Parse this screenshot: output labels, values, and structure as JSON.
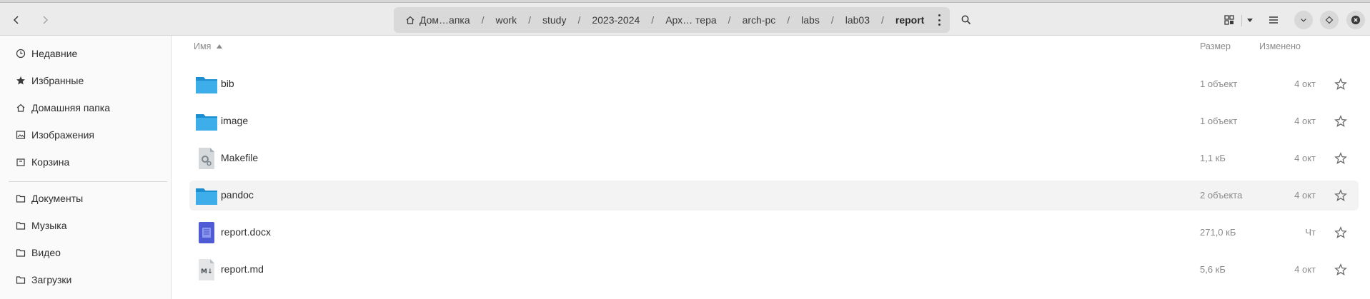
{
  "colors": {
    "folder": "#3daee9",
    "accent": "#3a3a3a",
    "doc": "#4f5bd5"
  },
  "pathbar": {
    "crumbs": [
      {
        "label": "Дом…апка",
        "icon": "home-icon"
      },
      {
        "label": "work"
      },
      {
        "label": "study"
      },
      {
        "label": "2023-2024"
      },
      {
        "label": "Арх… тера"
      },
      {
        "label": "arch-pc"
      },
      {
        "label": "labs"
      },
      {
        "label": "lab03"
      },
      {
        "label": "report"
      }
    ],
    "separator": "/"
  },
  "sidebar": {
    "items": [
      {
        "label": "Недавние",
        "icon": "clock-icon"
      },
      {
        "label": "Избранные",
        "icon": "star-icon"
      },
      {
        "label": "Домашняя папка",
        "icon": "home-icon"
      },
      {
        "label": "Изображения",
        "icon": "image-icon"
      },
      {
        "label": "Корзина",
        "icon": "trash-icon"
      },
      {
        "label": "Документы",
        "icon": "folder-icon"
      },
      {
        "label": "Музыка",
        "icon": "folder-icon"
      },
      {
        "label": "Видео",
        "icon": "folder-icon"
      },
      {
        "label": "Загрузки",
        "icon": "folder-icon"
      }
    ]
  },
  "columns": {
    "name": "Имя",
    "size": "Размер",
    "modified": "Изменено"
  },
  "files": [
    {
      "name": "bib",
      "size": "1 объект",
      "modified": "4 окт",
      "icon": "folder-icon"
    },
    {
      "name": "image",
      "size": "1 объект",
      "modified": "4 окт",
      "icon": "folder-icon"
    },
    {
      "name": "Makefile",
      "size": "1,1 кБ",
      "modified": "4 окт",
      "icon": "makefile-icon"
    },
    {
      "name": "pandoc",
      "size": "2 объекта",
      "modified": "4 окт",
      "icon": "folder-icon"
    },
    {
      "name": "report.docx",
      "size": "271,0 кБ",
      "modified": "Чт",
      "icon": "docx-icon"
    },
    {
      "name": "report.md",
      "size": "5,6 кБ",
      "modified": "4 окт",
      "icon": "markdown-icon"
    }
  ]
}
